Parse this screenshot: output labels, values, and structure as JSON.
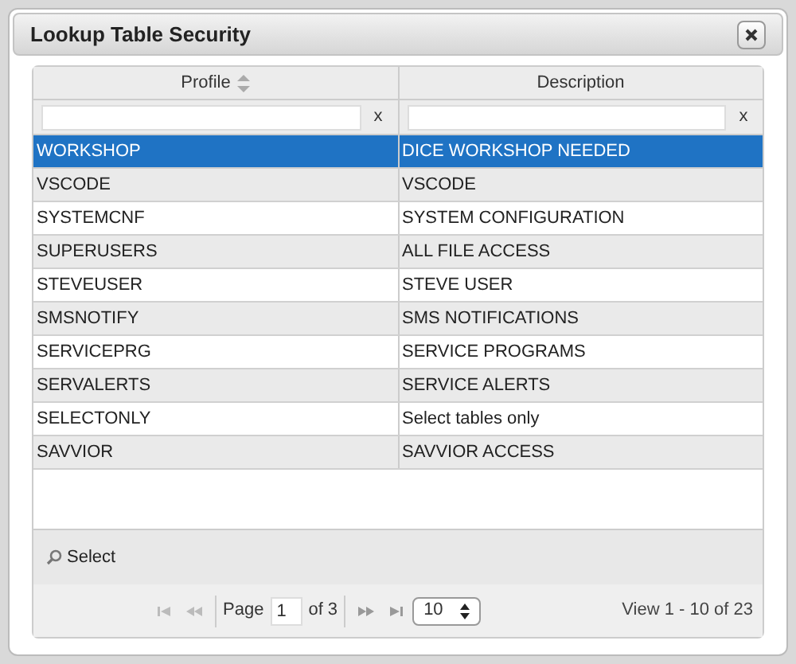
{
  "dialog": {
    "title": "Lookup Table Security"
  },
  "table": {
    "columns": [
      {
        "label": "Profile",
        "sortable": true,
        "filter_clear": "x"
      },
      {
        "label": "Description",
        "sortable": false,
        "filter_clear": "x"
      }
    ],
    "rows": [
      {
        "profile": "WORKSHOP",
        "description": "DICE WORKSHOP NEEDED",
        "selected": true
      },
      {
        "profile": "VSCODE",
        "description": "VSCODE",
        "selected": false
      },
      {
        "profile": "SYSTEMCNF",
        "description": "SYSTEM CONFIGURATION",
        "selected": false
      },
      {
        "profile": "SUPERUSERS",
        "description": "ALL FILE ACCESS",
        "selected": false
      },
      {
        "profile": "STEVEUSER",
        "description": "STEVE USER",
        "selected": false
      },
      {
        "profile": "SMSNOTIFY",
        "description": "SMS NOTIFICATIONS",
        "selected": false
      },
      {
        "profile": "SERVICEPRG",
        "description": "SERVICE PROGRAMS",
        "selected": false
      },
      {
        "profile": "SERVALERTS",
        "description": "SERVICE ALERTS",
        "selected": false
      },
      {
        "profile": "SELECTONLY",
        "description": "Select tables only",
        "selected": false
      },
      {
        "profile": "SAVVIOR",
        "description": "SAVVIOR ACCESS",
        "selected": false
      }
    ]
  },
  "toolbar": {
    "select_button": "Select"
  },
  "pager": {
    "page_label": "Page",
    "page": "1",
    "of_label": "of 3",
    "page_size": "10",
    "summary": "View 1 - 10 of 23"
  }
}
